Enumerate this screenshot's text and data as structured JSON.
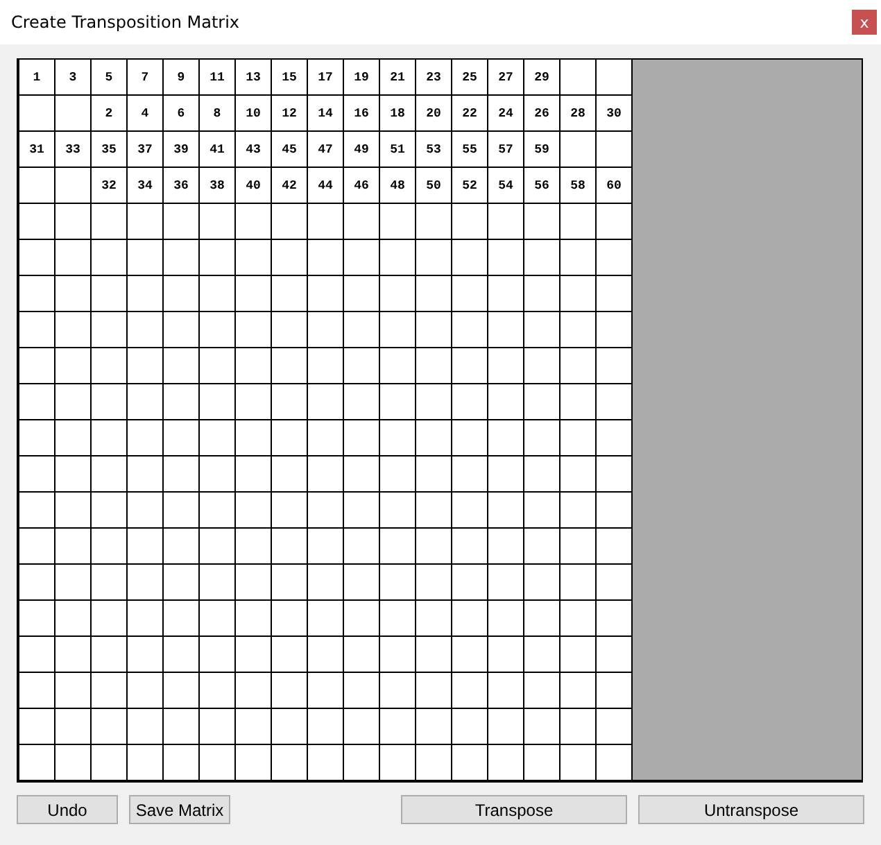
{
  "window": {
    "title": "Create Transposition Matrix",
    "close": "x"
  },
  "matrix": {
    "rows": [
      [
        "1",
        "3",
        "5",
        "7",
        "9",
        "11",
        "13",
        "15",
        "17",
        "19",
        "21",
        "23",
        "25",
        "27",
        "29",
        null,
        null
      ],
      [
        null,
        null,
        "2",
        "4",
        "6",
        "8",
        "10",
        "12",
        "14",
        "16",
        "18",
        "20",
        "22",
        "24",
        "26",
        "28",
        "30"
      ],
      [
        "31",
        "33",
        "35",
        "37",
        "39",
        "41",
        "43",
        "45",
        "47",
        "49",
        "51",
        "53",
        "55",
        "57",
        "59",
        null,
        null
      ],
      [
        null,
        null,
        "32",
        "34",
        "36",
        "38",
        "40",
        "42",
        "44",
        "46",
        "48",
        "50",
        "52",
        "54",
        "56",
        "58",
        "60"
      ],
      [
        null,
        null,
        null,
        null,
        null,
        null,
        null,
        null,
        null,
        null,
        null,
        null,
        null,
        null,
        null,
        null,
        null
      ],
      [
        null,
        null,
        null,
        null,
        null,
        null,
        null,
        null,
        null,
        null,
        null,
        null,
        null,
        null,
        null,
        null,
        null
      ],
      [
        null,
        null,
        null,
        null,
        null,
        null,
        null,
        null,
        null,
        null,
        null,
        null,
        null,
        null,
        null,
        null,
        null
      ],
      [
        null,
        null,
        null,
        null,
        null,
        null,
        null,
        null,
        null,
        null,
        null,
        null,
        null,
        null,
        null,
        null,
        null
      ],
      [
        null,
        null,
        null,
        null,
        null,
        null,
        null,
        null,
        null,
        null,
        null,
        null,
        null,
        null,
        null,
        null,
        null
      ],
      [
        null,
        null,
        null,
        null,
        null,
        null,
        null,
        null,
        null,
        null,
        null,
        null,
        null,
        null,
        null,
        null,
        null
      ],
      [
        null,
        null,
        null,
        null,
        null,
        null,
        null,
        null,
        null,
        null,
        null,
        null,
        null,
        null,
        null,
        null,
        null
      ],
      [
        null,
        null,
        null,
        null,
        null,
        null,
        null,
        null,
        null,
        null,
        null,
        null,
        null,
        null,
        null,
        null,
        null
      ],
      [
        null,
        null,
        null,
        null,
        null,
        null,
        null,
        null,
        null,
        null,
        null,
        null,
        null,
        null,
        null,
        null,
        null
      ],
      [
        null,
        null,
        null,
        null,
        null,
        null,
        null,
        null,
        null,
        null,
        null,
        null,
        null,
        null,
        null,
        null,
        null
      ],
      [
        null,
        null,
        null,
        null,
        null,
        null,
        null,
        null,
        null,
        null,
        null,
        null,
        null,
        null,
        null,
        null,
        null
      ],
      [
        null,
        null,
        null,
        null,
        null,
        null,
        null,
        null,
        null,
        null,
        null,
        null,
        null,
        null,
        null,
        null,
        null
      ],
      [
        null,
        null,
        null,
        null,
        null,
        null,
        null,
        null,
        null,
        null,
        null,
        null,
        null,
        null,
        null,
        null,
        null
      ],
      [
        null,
        null,
        null,
        null,
        null,
        null,
        null,
        null,
        null,
        null,
        null,
        null,
        null,
        null,
        null,
        null,
        null
      ],
      [
        null,
        null,
        null,
        null,
        null,
        null,
        null,
        null,
        null,
        null,
        null,
        null,
        null,
        null,
        null,
        null,
        null
      ],
      [
        null,
        null,
        null,
        null,
        null,
        null,
        null,
        null,
        null,
        null,
        null,
        null,
        null,
        null,
        null,
        null,
        null
      ]
    ]
  },
  "buttons": {
    "left": [
      "Undo",
      "Save Matrix"
    ],
    "right": [
      "Transpose",
      "Untranspose"
    ]
  }
}
